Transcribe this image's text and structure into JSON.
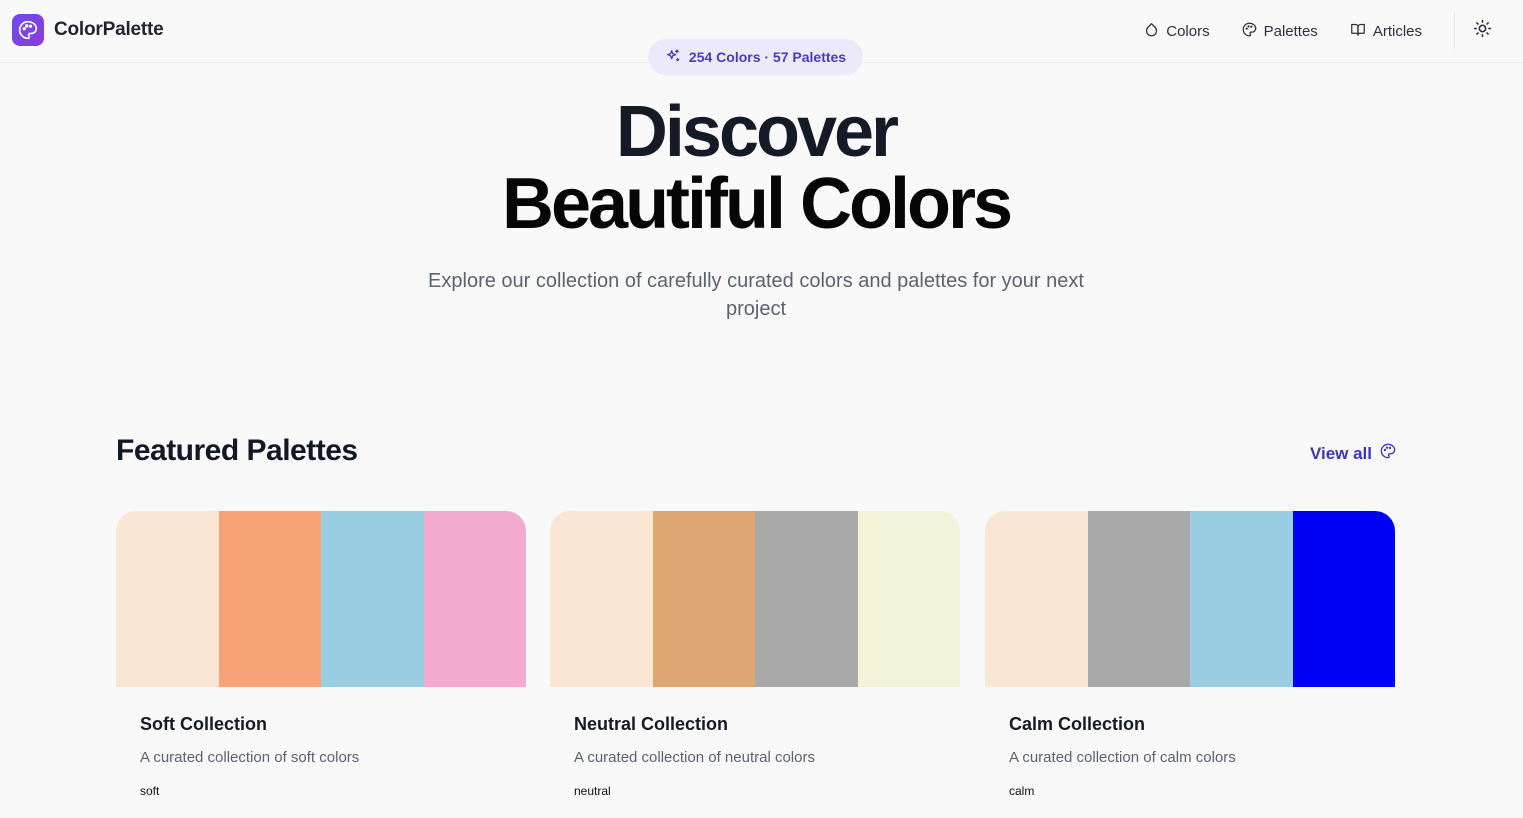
{
  "header": {
    "logo_text": "ColorPalette",
    "nav": [
      {
        "label": "Colors",
        "icon": "droplet-icon"
      },
      {
        "label": "Palettes",
        "icon": "palette-icon"
      },
      {
        "label": "Articles",
        "icon": "book-open-icon"
      }
    ],
    "theme_toggle_icon": "sun-icon"
  },
  "badge": {
    "text": "254 Colors · 57 Palettes",
    "icon": "sparkles-icon"
  },
  "hero": {
    "title_line1": "Discover",
    "title_line2": "Beautiful Colors",
    "subtitle": "Explore our collection of carefully curated colors and palettes for your next project"
  },
  "featured": {
    "title": "Featured Palettes",
    "view_all": "View all",
    "palettes": [
      {
        "name": "Soft Collection",
        "description": "A curated collection of soft colors",
        "tag": "soft",
        "colors": [
          "#f9e7d4",
          "#f8a478",
          "#98cde2",
          "#f2abce"
        ]
      },
      {
        "name": "Neutral Collection",
        "description": "A curated collection of neutral colors",
        "tag": "neutral",
        "colors": [
          "#f9e7d4",
          "#dda774",
          "#a9a9a9",
          "#f3f3d9"
        ]
      },
      {
        "name": "Calm Collection",
        "description": "A curated collection of calm colors",
        "tag": "calm",
        "colors": [
          "#f9e7d4",
          "#a9a9a9",
          "#98cde2",
          "#0000f5"
        ]
      }
    ]
  },
  "colors": {
    "accent": "#3b35b8",
    "badge_bg": "#ece9fb",
    "logo_gradient": [
      "#6d4bf0",
      "#8b3bd9"
    ]
  }
}
